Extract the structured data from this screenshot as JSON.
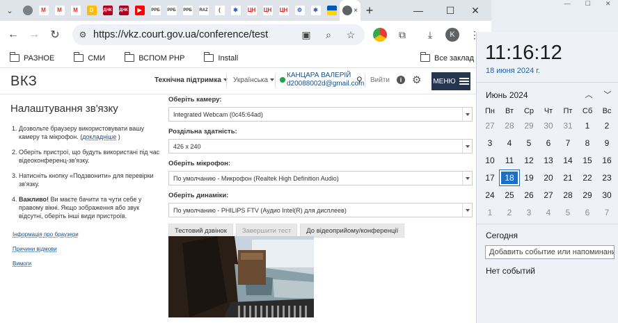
{
  "browser": {
    "new_tab": "+",
    "tab_close": "×",
    "favicons": [
      {
        "name": "chrome-globe",
        "label": "",
        "bg": "#7b8088"
      },
      {
        "name": "gmail",
        "label": "M",
        "bg": "#ffffff",
        "fg": "#d93025"
      },
      {
        "name": "gmail",
        "label": "M",
        "bg": "#ffffff",
        "fg": "#d93025"
      },
      {
        "name": "gmail",
        "label": "M",
        "bg": "#ffffff",
        "fg": "#d93025"
      },
      {
        "name": "gdrive",
        "label": "D",
        "bg": "#fbbc04"
      },
      {
        "name": "news",
        "label": "ДНК",
        "bg": "#b00020"
      },
      {
        "name": "news",
        "label": "ДНК",
        "bg": "#b00020"
      },
      {
        "name": "youtube",
        "label": "▶",
        "bg": "#ff0000"
      },
      {
        "name": "rrb",
        "label": "РРБ",
        "bg": "#ffffff",
        "fg": "#333"
      },
      {
        "name": "rrb",
        "label": "РРБ",
        "bg": "#ffffff",
        "fg": "#333"
      },
      {
        "name": "rrb",
        "label": "РРБ",
        "bg": "#ffffff",
        "fg": "#333"
      },
      {
        "name": "raz",
        "label": "RAZ",
        "bg": "#ffffff",
        "fg": "#333"
      },
      {
        "name": "loading",
        "label": "(",
        "bg": "#ffffff",
        "fg": "#555"
      },
      {
        "name": "extension",
        "label": "✱",
        "bg": "#ffffff",
        "fg": "#2f5fb8"
      },
      {
        "name": "cn",
        "label": "ЦН",
        "bg": "#ffffff",
        "fg": "#c62828"
      },
      {
        "name": "cn",
        "label": "ЦН",
        "bg": "#ffffff",
        "fg": "#c62828"
      },
      {
        "name": "cn",
        "label": "ЦН",
        "bg": "#ffffff",
        "fg": "#c62828"
      },
      {
        "name": "gear",
        "label": "⚙",
        "bg": "#ffffff",
        "fg": "#2f5fb8"
      },
      {
        "name": "extension",
        "label": "✱",
        "bg": "#ffffff",
        "fg": "#2f5fb8"
      },
      {
        "name": "ukraine-flag",
        "label": "",
        "bg": "#ffd500"
      }
    ],
    "url": "https://vkz.court.gov.ua/conference/test",
    "profile_initial": "K",
    "bookmarks": [
      "РАЗНОЕ",
      "СМИ",
      "ВСПОМ PHP",
      "Install"
    ],
    "all_bookmarks": "Все заклад"
  },
  "site": {
    "logo": "ВКЗ",
    "support": "Технічна підтримка",
    "language": "Українська",
    "user_name": "КАНЦАРА ВАЛЕРІЙ",
    "user_email": "d20088002d@gmail.com",
    "logout": "Вийти",
    "menu": "МЕНЮ"
  },
  "sidebar": {
    "title": "Налаштування зв'язку",
    "step1_text": "Дозвольте браузеру використовувати вашу камеру та мікрофон. (",
    "step1_link": "докладніше",
    "step1_end": " )",
    "step2": "Оберіть пристрої, що будуть використані під час відеоконференц-зв'язку.",
    "step3": "Натисніть кнопку «Подзвонити» для перевірки зв'язку.",
    "step4_bold": "Важливо!",
    "step4": " Ви маєте бачити та чути себе у правому вікні. Якщо зображення або звук відсутні, оберіть інші види пристроїв.",
    "links": [
      "Інформація про браузери",
      "Причини відмови",
      "Вимоги"
    ]
  },
  "form": {
    "camera_label": "Оберіть камеру:",
    "camera_value": "Integrated Webcam (0c45:64ad)",
    "resolution_label": "Роздільна здатність:",
    "resolution_value": "426 x 240",
    "mic_label": "Оберіть мікрофон:",
    "mic_value": "По умолчанию - Микрофон (Realtek High Definition Audio)",
    "speakers_label": "Оберіть динаміки:",
    "speakers_value": "По умолчанию - PHILIPS FTV (Аудио Intel(R) для дисплеев)",
    "btn_test_call": "Тестовий дзвінок",
    "btn_finish": "Завершити тест",
    "btn_reception": "До відеоприйому/конференції"
  },
  "calendar": {
    "time": "11:16:12",
    "date": "18 июня 2024 г.",
    "month": "Июнь 2024",
    "weekdays": [
      "Пн",
      "Вт",
      "Ср",
      "Чт",
      "Пт",
      "Сб",
      "Вс"
    ],
    "days": [
      [
        "27",
        "28",
        "29",
        "30",
        "31",
        "1",
        "2"
      ],
      [
        "3",
        "4",
        "5",
        "6",
        "7",
        "8",
        "9"
      ],
      [
        "10",
        "11",
        "12",
        "13",
        "14",
        "15",
        "16"
      ],
      [
        "17",
        "18",
        "19",
        "20",
        "21",
        "22",
        "23"
      ],
      [
        "24",
        "25",
        "26",
        "27",
        "28",
        "29",
        "30"
      ],
      [
        "1",
        "2",
        "3",
        "4",
        "5",
        "6",
        "7"
      ]
    ],
    "muted_rows": {
      "0": [
        0,
        1,
        2,
        3,
        4
      ],
      "5": [
        0,
        1,
        2,
        3,
        4,
        5,
        6
      ]
    },
    "today": "18",
    "today_label": "Сегодня",
    "event_placeholder": "Добавить событие или напоминание",
    "no_events": "Нет событий"
  },
  "colors": {
    "menu_bg": "#25344f",
    "link": "#1a4f8a",
    "online": "#22a04b",
    "today_bg": "#1a6fc9"
  }
}
